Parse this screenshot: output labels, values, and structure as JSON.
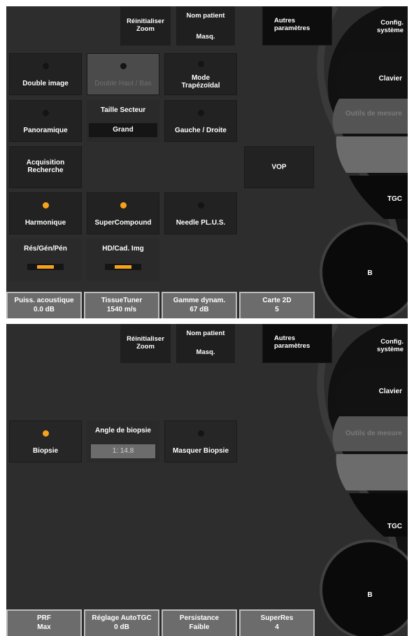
{
  "screen1": {
    "top": {
      "reset_zoom": [
        "Réinitialiser",
        "Zoom"
      ],
      "patient_name": [
        "Nom patient",
        "Masq."
      ],
      "other_params": [
        "Autres",
        "paramètres"
      ],
      "system_config": [
        "Config.",
        "système"
      ]
    },
    "right_menu": {
      "keyboard": "Clavier",
      "measure_tools": "Outils de mesure",
      "tgc": "TGC",
      "b_mode": "B"
    },
    "buttons": {
      "dual_image": "Double image",
      "dual_up_down": "Double Haut / Bas",
      "trapezoid_mode": [
        "Mode",
        "Trapézoïdal"
      ],
      "panoramic": "Panoramique",
      "sector_size_label": "Taille Secteur",
      "sector_size_value": "Grand",
      "left_right": "Gauche / Droite",
      "acquisition_search": [
        "Acquisition",
        "Recherche"
      ],
      "vop": "VOP",
      "harmonic": "Harmonique",
      "supercompound": "SuperCompound",
      "needle_plus": "Needle PL.U.S.",
      "res_gen_pen": "Rés/Gén/Pén",
      "hd_frame_rate": "HD/Cad. Img"
    },
    "leds": {
      "harmonic": "on",
      "supercompound": "on",
      "needle_plus": "off"
    },
    "bottom": [
      {
        "label": "Puiss. acoustique",
        "value": "0.0 dB"
      },
      {
        "label": "TissueTuner",
        "value": "1540 m/s"
      },
      {
        "label": "Gamme dynam.",
        "value": "67 dB"
      },
      {
        "label": "Carte 2D",
        "value": "5"
      }
    ]
  },
  "screen2": {
    "top": {
      "reset_zoom": [
        "Réinitialiser",
        "Zoom"
      ],
      "patient_name": [
        "Nom patient",
        "Masq."
      ],
      "other_params": [
        "Autres",
        "paramètres"
      ],
      "system_config": [
        "Config.",
        "système"
      ]
    },
    "right_menu": {
      "keyboard": "Clavier",
      "measure_tools": "Outils de mesure",
      "tgc": "TGC",
      "b_mode": "B"
    },
    "buttons": {
      "biopsy": "Biopsie",
      "biopsy_angle_label": "Angle de biopsie",
      "biopsy_angle_value": "1: 14.8",
      "hide_biopsy": "Masquer Biopsie"
    },
    "leds": {
      "biopsy": "on",
      "hide_biopsy": "off"
    },
    "bottom": [
      {
        "label": "PRF",
        "value": "Max"
      },
      {
        "label": "Réglage AutoTGC",
        "value": "0 dB"
      },
      {
        "label": "Persistance",
        "value": "Faible"
      },
      {
        "label": "SuperRes",
        "value": "4"
      }
    ]
  },
  "colors": {
    "background": "#2d2d2d",
    "button": "#222222",
    "led_on": "#f7a21b",
    "bottom_bar": "#6c6c6c"
  }
}
